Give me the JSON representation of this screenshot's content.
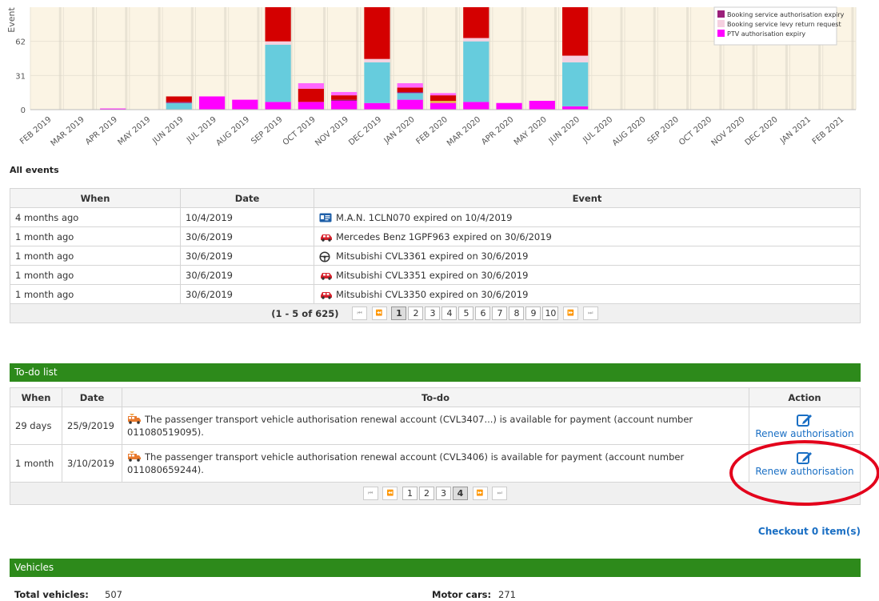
{
  "chart_data": {
    "type": "bar",
    "stacked": true,
    "ylabel": "Event",
    "yticks": [
      0,
      31,
      62
    ],
    "ylim": [
      0,
      93
    ],
    "categories": [
      "FEB 2019",
      "MAR 2019",
      "APR 2019",
      "MAY 2019",
      "JUN 2019",
      "JUL 2019",
      "AUG 2019",
      "SEP 2019",
      "OCT 2019",
      "NOV 2019",
      "DEC 2019",
      "JAN 2020",
      "FEB 2020",
      "MAR 2020",
      "APR 2020",
      "MAY 2020",
      "JUN 2020",
      "JUL 2020",
      "AUG 2020",
      "SEP 2020",
      "OCT 2020",
      "NOV 2020",
      "DEC 2020",
      "JAN 2021",
      "FEB 2021"
    ],
    "series": [
      {
        "name": "PTV authorisation expiry",
        "color": "#ff00ff",
        "values": [
          0,
          0,
          1,
          0,
          0,
          12,
          9,
          7,
          7,
          8,
          6,
          9,
          6,
          7,
          6,
          8,
          3,
          0,
          0,
          0,
          0,
          0,
          0,
          0,
          0
        ]
      },
      {
        "name": "",
        "color": "#66ccdd",
        "values": [
          0,
          0,
          0,
          0,
          6,
          0,
          0,
          52,
          0,
          0,
          37,
          6,
          0,
          55,
          0,
          0,
          40,
          0,
          0,
          0,
          0,
          0,
          0,
          0,
          0
        ]
      },
      {
        "name": "",
        "color": "#e8b24a",
        "values": [
          0,
          0,
          0,
          0,
          0,
          0,
          0,
          0,
          0,
          0,
          0,
          0,
          2,
          0,
          0,
          0,
          0,
          0,
          0,
          0,
          0,
          0,
          0,
          0,
          0
        ]
      },
      {
        "name": "Booking service levy return request",
        "color": "#f5d0e0",
        "values": [
          0,
          0,
          0,
          0,
          0,
          0,
          0,
          3,
          0,
          0,
          3,
          0,
          0,
          3,
          0,
          0,
          6,
          0,
          0,
          0,
          0,
          0,
          0,
          0,
          0
        ]
      },
      {
        "name": "Booking service authorisation expiry",
        "color": "#9b1f7a",
        "values": [
          0,
          0,
          0,
          0,
          1,
          0,
          0,
          0,
          0,
          1,
          0,
          1,
          0,
          0,
          0,
          0,
          0,
          0,
          0,
          0,
          0,
          0,
          0,
          0,
          0
        ]
      },
      {
        "name": "",
        "color": "#d40000",
        "values": [
          0,
          0,
          0,
          0,
          5,
          0,
          0,
          32,
          12,
          4,
          60,
          4,
          5,
          40,
          0,
          0,
          45,
          0,
          0,
          0,
          0,
          0,
          0,
          0,
          0
        ]
      },
      {
        "name": "",
        "color": "#ff66ff",
        "values": [
          0,
          0,
          0,
          0,
          0,
          0,
          0,
          0,
          5,
          3,
          0,
          4,
          2,
          0,
          0,
          0,
          0,
          0,
          0,
          0,
          0,
          0,
          0,
          0,
          0
        ]
      }
    ],
    "legend_position": "top-right",
    "legend_entries": [
      "Booking service authorisation expiry",
      "Booking service levy return request",
      "PTV authorisation expiry"
    ]
  },
  "all_events": {
    "title": "All events",
    "headers": [
      "When",
      "Date",
      "Event"
    ],
    "rows": [
      {
        "when": "4 months ago",
        "date": "10/4/2019",
        "event": "M.A.N. 1CLN070 expired on 10/4/2019",
        "icon": "id-card-icon"
      },
      {
        "when": "1 month ago",
        "date": "30/6/2019",
        "event": "Mercedes Benz 1GPF963 expired on 30/6/2019",
        "icon": "car-icon"
      },
      {
        "when": "1 month ago",
        "date": "30/6/2019",
        "event": "Mitsubishi CVL3361 expired on 30/6/2019",
        "icon": "steering-wheel-icon"
      },
      {
        "when": "1 month ago",
        "date": "30/6/2019",
        "event": "Mitsubishi CVL3351 expired on 30/6/2019",
        "icon": "car-icon"
      },
      {
        "when": "1 month ago",
        "date": "30/6/2019",
        "event": "Mitsubishi CVL3350 expired on 30/6/2019",
        "icon": "car-icon"
      }
    ],
    "pager": {
      "count": "(1 - 5 of 625)",
      "first": "⏮",
      "prev": "⏪",
      "next": "⏩",
      "last": "⏭",
      "pages": [
        "1",
        "2",
        "3",
        "4",
        "5",
        "6",
        "7",
        "8",
        "9",
        "10"
      ],
      "current": "1"
    }
  },
  "todo": {
    "title": "To-do list",
    "headers": [
      "When",
      "Date",
      "To-do",
      "Action"
    ],
    "rows": [
      {
        "when": "29 days",
        "date": "25/9/2019",
        "text": "The passenger transport vehicle authorisation renewal account (CVL3407...) is available for payment (account number 011080519095).",
        "action": "Renew authorisation"
      },
      {
        "when": "1 month",
        "date": "3/10/2019",
        "text": "The passenger transport vehicle authorisation renewal account (CVL3406) is available for payment (account number 011080659244).",
        "action": "Renew authorisation"
      }
    ],
    "pager": {
      "first": "⏮",
      "prev": "⏪",
      "next": "⏩",
      "last": "⏭",
      "pages": [
        "1",
        "2",
        "3",
        "4"
      ],
      "current": "4"
    }
  },
  "checkout": "Checkout 0 item(s)",
  "vehicles": {
    "title": "Vehicles",
    "total_label": "Total vehicles:",
    "total_value": "507",
    "motor_label": "Motor cars:",
    "motor_value": "271"
  }
}
